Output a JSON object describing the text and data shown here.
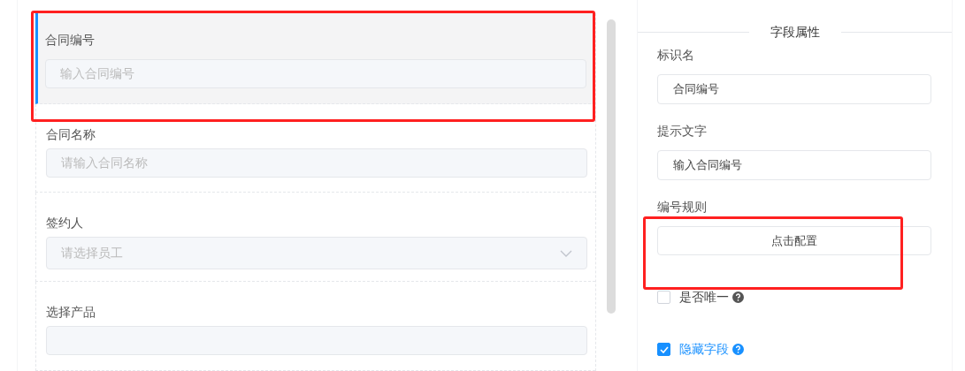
{
  "form_fields": [
    {
      "kind": "input",
      "label": "合同编号",
      "placeholder": "输入合同编号",
      "selected": true
    },
    {
      "kind": "input",
      "label": "合同名称",
      "placeholder": "请输入合同名称",
      "selected": false
    },
    {
      "kind": "select",
      "label": "签约人",
      "placeholder": "请选择员工",
      "selected": false
    },
    {
      "kind": "input",
      "label": "选择产品",
      "selected": false
    }
  ],
  "properties_panel": {
    "title": "字段属性",
    "items": [
      {
        "kind": "text",
        "label": "标识名",
        "value": "合同编号"
      },
      {
        "kind": "text",
        "label": "提示文字",
        "value": "输入合同编号"
      },
      {
        "kind": "button",
        "label": "编号规则",
        "button": "点击配置"
      },
      {
        "kind": "checkbox",
        "label": "是否唯一",
        "checked": false,
        "help": true
      },
      {
        "kind": "checkbox",
        "label": "隐藏字段",
        "checked": true,
        "help": true
      }
    ]
  },
  "highlights": [
    {
      "color": "#ff2020"
    },
    {
      "color": "#ff2020"
    }
  ]
}
